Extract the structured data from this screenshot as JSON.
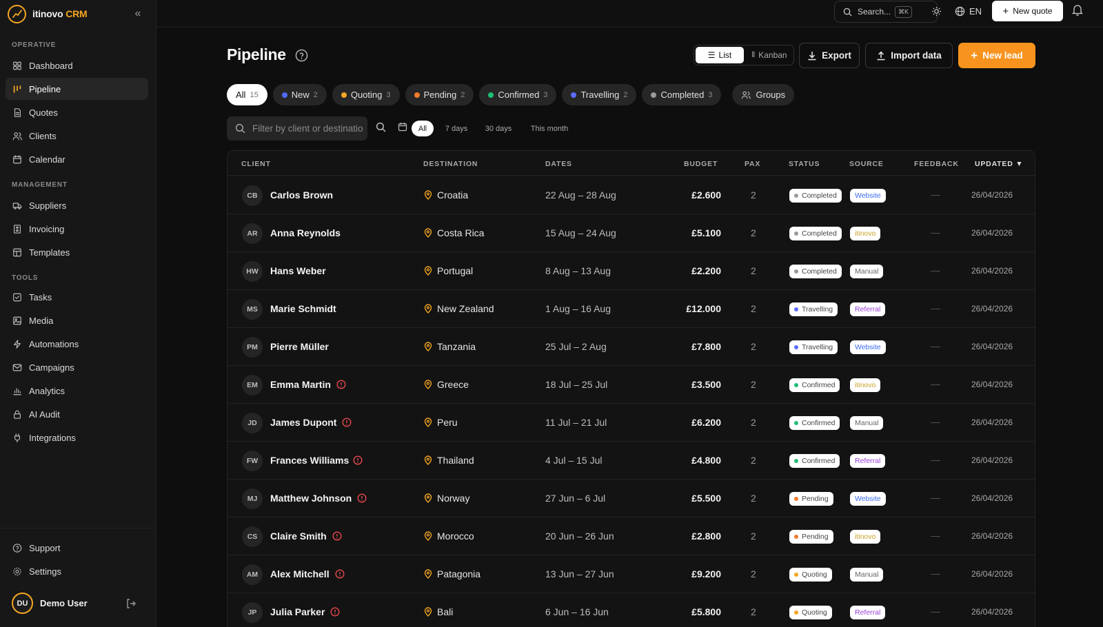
{
  "app": {
    "brand_main": "itinovo",
    "brand_accent": "CRM"
  },
  "sidebar": {
    "sections": {
      "operative": "OPERATIVE",
      "management": "MANAGEMENT",
      "tools": "TOOLS"
    },
    "items": [
      {
        "label": "Dashboard",
        "icon": "dashboard-icon"
      },
      {
        "label": "Pipeline",
        "icon": "pipeline-icon",
        "active": true
      },
      {
        "label": "Quotes",
        "icon": "document-icon"
      },
      {
        "label": "Clients",
        "icon": "users-icon"
      },
      {
        "label": "Calendar",
        "icon": "calendar-icon"
      },
      {
        "label": "Suppliers",
        "icon": "truck-icon"
      },
      {
        "label": "Invoicing",
        "icon": "invoice-icon"
      },
      {
        "label": "Templates",
        "icon": "template-icon"
      },
      {
        "label": "Tasks",
        "icon": "checkbox-icon"
      },
      {
        "label": "Media",
        "icon": "image-icon"
      },
      {
        "label": "Automations",
        "icon": "bolt-icon"
      },
      {
        "label": "Campaigns",
        "icon": "mail-icon"
      },
      {
        "label": "Analytics",
        "icon": "chart-icon"
      },
      {
        "label": "AI Audit",
        "icon": "lock-icon"
      },
      {
        "label": "Integrations",
        "icon": "plug-icon"
      }
    ],
    "support": "Support",
    "settings": "Settings",
    "user": {
      "initials": "DU",
      "name": "Demo User"
    }
  },
  "topbar": {
    "search": "Search...",
    "shortcut": "⌘K",
    "lang": "EN",
    "new_quote": "New quote"
  },
  "page": {
    "title": "Pipeline",
    "view_list": "List",
    "view_kanban": "Kanban",
    "export": "Export",
    "import": "Import data",
    "new_lead": "New lead"
  },
  "tabs": [
    {
      "label": "All",
      "count": "15"
    },
    {
      "label": "New",
      "count": "2",
      "color": "#4f6bff"
    },
    {
      "label": "Quoting",
      "count": "3",
      "color": "#f5a623"
    },
    {
      "label": "Pending",
      "count": "2",
      "color": "#f27a2a"
    },
    {
      "label": "Confirmed",
      "count": "3",
      "color": "#1fbf75"
    },
    {
      "label": "Travelling",
      "count": "2",
      "color": "#5b6cff"
    },
    {
      "label": "Completed",
      "count": "3",
      "color": "#9a9a9a"
    },
    {
      "label": "Groups"
    }
  ],
  "filter": {
    "placeholder": "Filter by client or destination",
    "ranges": [
      "All",
      "7 days",
      "30 days",
      "This month"
    ]
  },
  "table": {
    "headers": {
      "client": "CLIENT",
      "destination": "DESTINATION",
      "dates": "DATES",
      "budget": "BUDGET",
      "pax": "PAX",
      "status": "STATUS",
      "source": "SOURCE",
      "feedback": "FEEDBACK",
      "updated": "UPDATED ▼"
    },
    "status_colors": {
      "Completed": "#9a9a9a",
      "Travelling": "#5b6cff",
      "Confirmed": "#1fbf75",
      "Pending": "#f27a2a",
      "Quoting": "#f5a623"
    },
    "source_colors": {
      "Website": "#3b6cf0",
      "itinovo": "#c9a227",
      "Manual": "#666666",
      "Referral": "#9b40d9"
    },
    "rows": [
      {
        "initials": "CB",
        "name": "Carlos Brown",
        "alert": false,
        "destination": "Croatia",
        "dates": "22 Aug – 28 Aug",
        "budget": "£2.600",
        "pax": "2",
        "status": "Completed",
        "source": "Website",
        "feedback": "—",
        "updated": "26/04/2026"
      },
      {
        "initials": "AR",
        "name": "Anna Reynolds",
        "alert": false,
        "destination": "Costa Rica",
        "dates": "15 Aug – 24 Aug",
        "budget": "£5.100",
        "pax": "2",
        "status": "Completed",
        "source": "itinovo",
        "feedback": "—",
        "updated": "26/04/2026"
      },
      {
        "initials": "HW",
        "name": "Hans Weber",
        "alert": false,
        "destination": "Portugal",
        "dates": "8 Aug – 13 Aug",
        "budget": "£2.200",
        "pax": "2",
        "status": "Completed",
        "source": "Manual",
        "feedback": "—",
        "updated": "26/04/2026"
      },
      {
        "initials": "MS",
        "name": "Marie Schmidt",
        "alert": false,
        "destination": "New Zealand",
        "dates": "1 Aug – 16 Aug",
        "budget": "£12.000",
        "pax": "2",
        "status": "Travelling",
        "source": "Referral",
        "feedback": "—",
        "updated": "26/04/2026"
      },
      {
        "initials": "PM",
        "name": "Pierre Müller",
        "alert": false,
        "destination": "Tanzania",
        "dates": "25 Jul – 2 Aug",
        "budget": "£7.800",
        "pax": "2",
        "status": "Travelling",
        "source": "Website",
        "feedback": "—",
        "updated": "26/04/2026"
      },
      {
        "initials": "EM",
        "name": "Emma Martin",
        "alert": true,
        "destination": "Greece",
        "dates": "18 Jul – 25 Jul",
        "budget": "£3.500",
        "pax": "2",
        "status": "Confirmed",
        "source": "itinovo",
        "feedback": "—",
        "updated": "26/04/2026"
      },
      {
        "initials": "JD",
        "name": "James Dupont",
        "alert": true,
        "destination": "Peru",
        "dates": "11 Jul – 21 Jul",
        "budget": "£6.200",
        "pax": "2",
        "status": "Confirmed",
        "source": "Manual",
        "feedback": "—",
        "updated": "26/04/2026"
      },
      {
        "initials": "FW",
        "name": "Frances Williams",
        "alert": true,
        "destination": "Thailand",
        "dates": "4 Jul – 15 Jul",
        "budget": "£4.800",
        "pax": "2",
        "status": "Confirmed",
        "source": "Referral",
        "feedback": "—",
        "updated": "26/04/2026"
      },
      {
        "initials": "MJ",
        "name": "Matthew Johnson",
        "alert": true,
        "destination": "Norway",
        "dates": "27 Jun – 6 Jul",
        "budget": "£5.500",
        "pax": "2",
        "status": "Pending",
        "source": "Website",
        "feedback": "—",
        "updated": "26/04/2026"
      },
      {
        "initials": "CS",
        "name": "Claire Smith",
        "alert": true,
        "destination": "Morocco",
        "dates": "20 Jun – 26 Jun",
        "budget": "£2.800",
        "pax": "2",
        "status": "Pending",
        "source": "itinovo",
        "feedback": "—",
        "updated": "26/04/2026"
      },
      {
        "initials": "AM",
        "name": "Alex Mitchell",
        "alert": true,
        "destination": "Patagonia",
        "dates": "13 Jun – 27 Jun",
        "budget": "£9.200",
        "pax": "2",
        "status": "Quoting",
        "source": "Manual",
        "feedback": "—",
        "updated": "26/04/2026"
      },
      {
        "initials": "JP",
        "name": "Julia Parker",
        "alert": true,
        "destination": "Bali",
        "dates": "6 Jun – 16 Jun",
        "budget": "£5.800",
        "pax": "2",
        "status": "Quoting",
        "source": "Referral",
        "feedback": "—",
        "updated": "26/04/2026"
      }
    ]
  }
}
